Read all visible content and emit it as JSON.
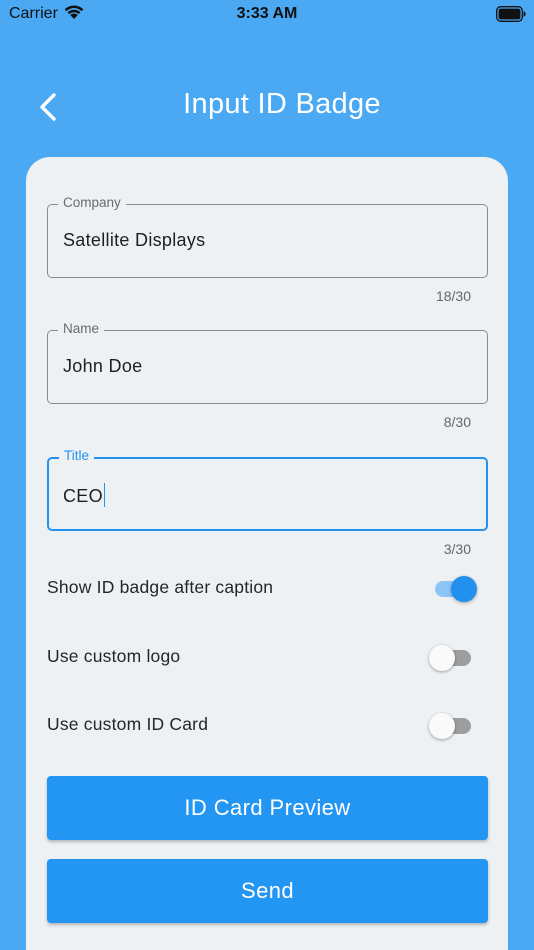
{
  "status_bar": {
    "carrier": "Carrier",
    "time": "3:33 AM"
  },
  "nav": {
    "title": "Input ID Badge"
  },
  "form": {
    "company": {
      "label": "Company",
      "value": "Satellite Displays",
      "counter": "18/30"
    },
    "name": {
      "label": "Name",
      "value": "John Doe",
      "counter": "8/30"
    },
    "title": {
      "label": "Title",
      "value": "CEO",
      "counter": "3/30"
    }
  },
  "toggles": {
    "show_badge": {
      "label": "Show ID badge after caption",
      "on": true
    },
    "custom_logo": {
      "label": "Use custom logo",
      "on": false
    },
    "custom_card": {
      "label": "Use custom ID Card",
      "on": false
    }
  },
  "buttons": {
    "preview": "ID Card Preview",
    "send": "Send"
  },
  "colors": {
    "background": "#4aa9f2",
    "card": "#eef1f3",
    "accent": "#2395f2"
  }
}
